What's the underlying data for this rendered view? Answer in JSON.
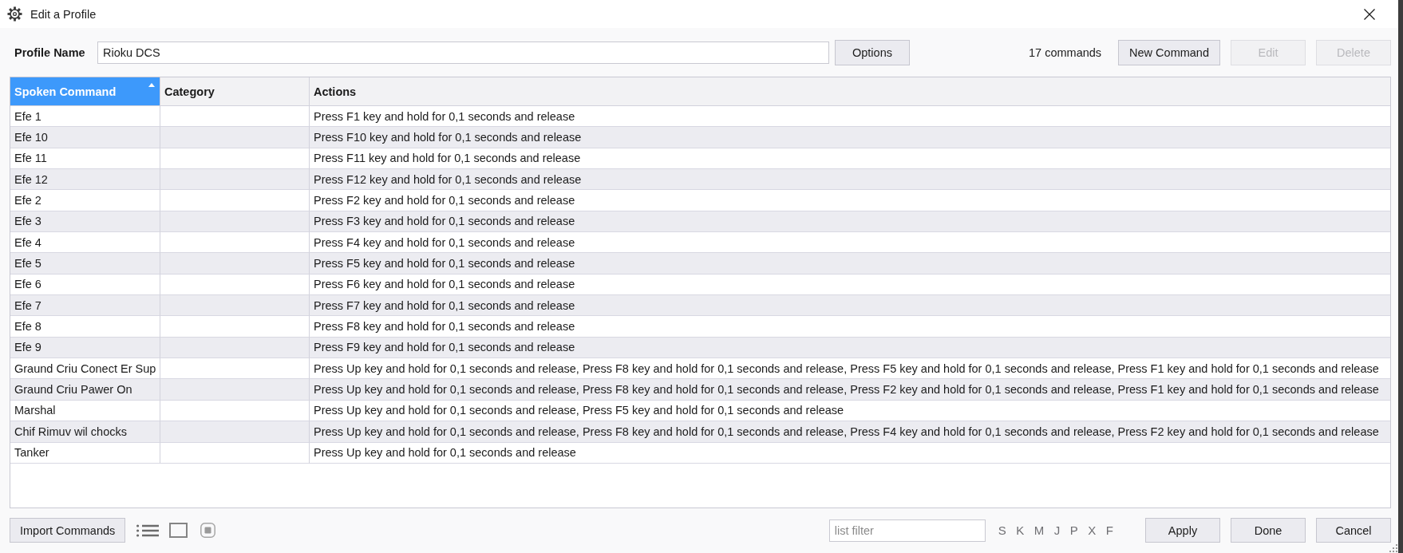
{
  "window": {
    "title": "Edit a Profile"
  },
  "profile": {
    "label": "Profile Name",
    "value": "Rioku DCS",
    "options_button": "Options"
  },
  "toolbar": {
    "count": "17 commands",
    "buttons": [
      {
        "label": "New Command",
        "disabled": false
      },
      {
        "label": "Edit",
        "disabled": true
      },
      {
        "label": "Delete",
        "disabled": true
      }
    ]
  },
  "table": {
    "columns": [
      {
        "label": "Spoken Command",
        "selected": true,
        "sorted": true
      },
      {
        "label": "Category",
        "selected": false,
        "sorted": false
      },
      {
        "label": "Actions",
        "selected": false,
        "sorted": false
      }
    ],
    "rows": [
      {
        "spoken_command": "Efe 1",
        "actions": "Press F1 key and hold for 0,1 seconds and release"
      },
      {
        "spoken_command": "Efe 10",
        "actions": "Press F10 key and hold for 0,1 seconds and release"
      },
      {
        "spoken_command": "Efe 11",
        "actions": "Press F11 key and hold for 0,1 seconds and release"
      },
      {
        "spoken_command": "Efe 12",
        "actions": "Press F12 key and hold for 0,1 seconds and release"
      },
      {
        "spoken_command": "Efe 2",
        "actions": "Press F2 key and hold for 0,1 seconds and release"
      },
      {
        "spoken_command": "Efe 3",
        "actions": "Press F3 key and hold for 0,1 seconds and release"
      },
      {
        "spoken_command": "Efe 4",
        "actions": "Press F4 key and hold for 0,1 seconds and release"
      },
      {
        "spoken_command": "Efe 5",
        "actions": "Press F5 key and hold for 0,1 seconds and release"
      },
      {
        "spoken_command": "Efe 6",
        "actions": "Press F6 key and hold for 0,1 seconds and release"
      },
      {
        "spoken_command": "Efe 7",
        "actions": "Press F7 key and hold for 0,1 seconds and release"
      },
      {
        "spoken_command": "Efe 8",
        "actions": "Press F8 key and hold for 0,1 seconds and release"
      },
      {
        "spoken_command": "Efe 9",
        "actions": "Press F9 key and hold for 0,1 seconds and release"
      },
      {
        "spoken_command": "Graund Criu Conect Er Sup",
        "actions": "Press Up key and hold for 0,1 seconds and release, Press F8 key and hold for 0,1 seconds and release, Press F5 key and hold for 0,1 seconds and release, Press F1 key and hold for 0,1 seconds and release"
      },
      {
        "spoken_command": "Graund Criu Pawer On",
        "actions": "Press Up key and hold for 0,1 seconds and release, Press F8 key and hold for 0,1 seconds and release, Press F2 key and hold for 0,1 seconds and release, Press F1 key and hold for 0,1 seconds and release"
      },
      {
        "spoken_command": "Marshal",
        "actions": "Press Up key and hold for 0,1 seconds and release, Press F5 key and hold for 0,1 seconds and release"
      },
      {
        "spoken_command": "Chif Rimuv wil chocks",
        "actions": "Press Up key and hold for 0,1 seconds and release, Press F8 key and hold for 0,1 seconds and release, Press F4 key and hold for 0,1 seconds and release, Press F2 key and hold for 0,1 seconds and release"
      },
      {
        "spoken_command": "Tanker",
        "actions": "Press Up key and hold for 0,1 seconds and release"
      }
    ]
  },
  "footer": {
    "import_button": "Import Commands",
    "filter": {
      "placeholder": "list filter"
    },
    "filter_letters": [
      "S",
      "K",
      "M",
      "J",
      "P",
      "X",
      "F"
    ],
    "buttons": [
      "Apply",
      "Done",
      "Cancel"
    ]
  }
}
